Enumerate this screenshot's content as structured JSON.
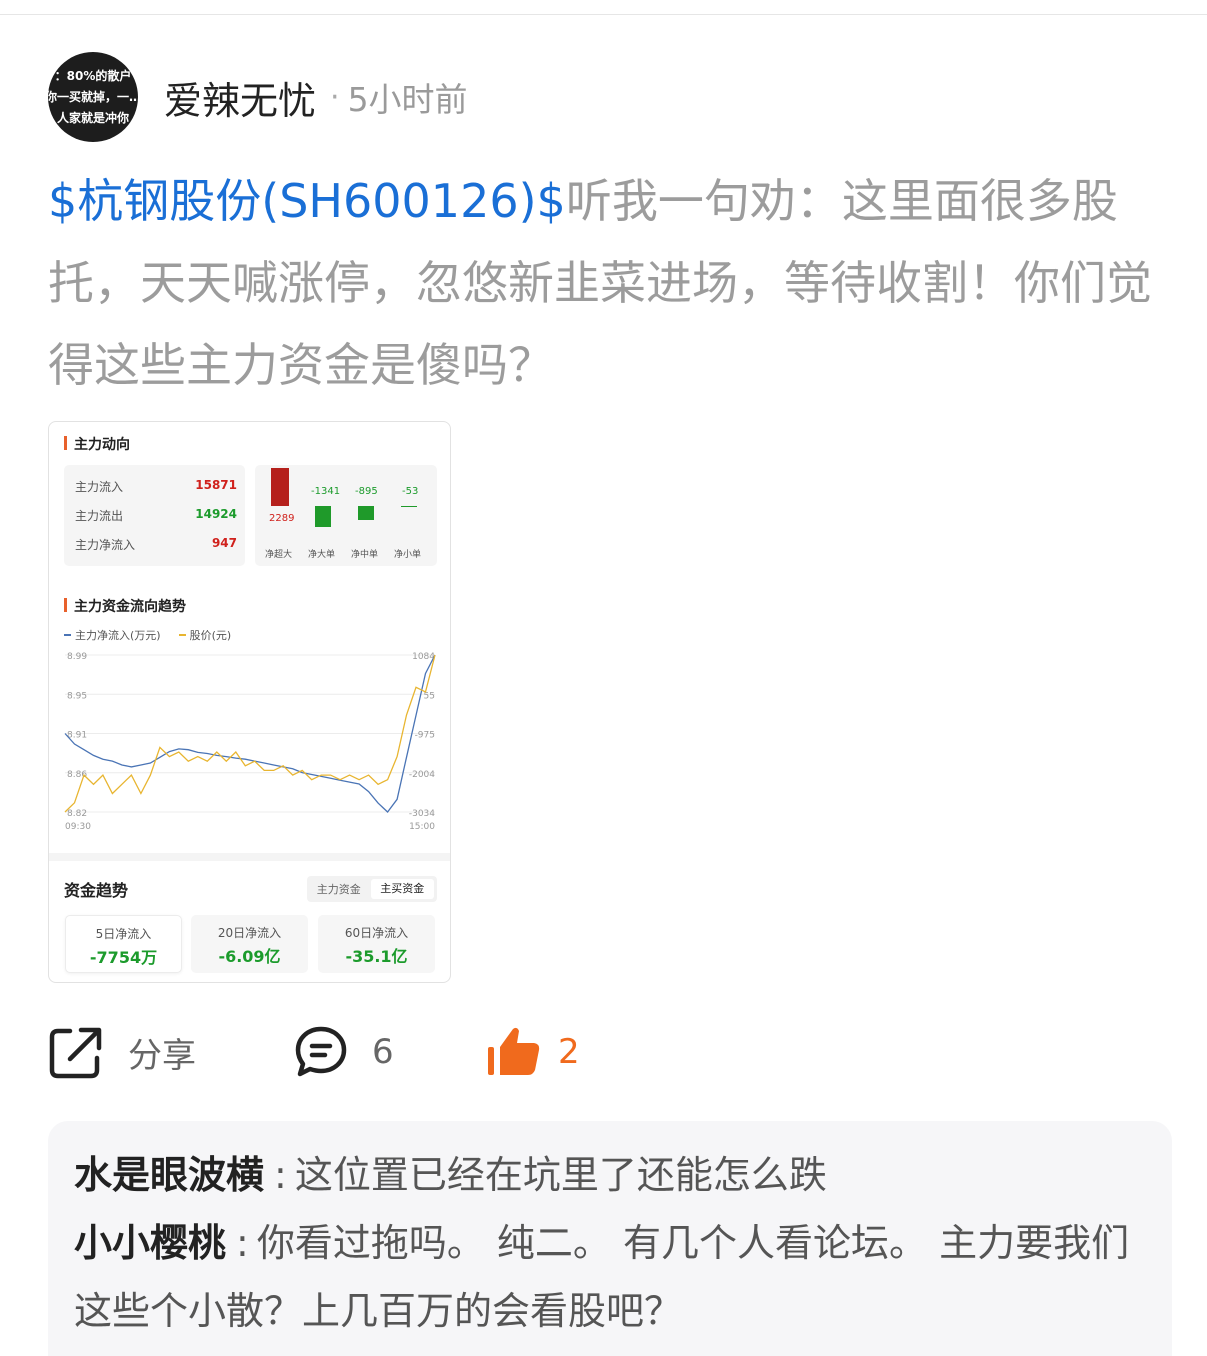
{
  "author": {
    "avatar_lines": [
      "：80%的散户",
      "你一买就掉，一…",
      "人家就是冲你"
    ],
    "name": "爱辣无忧",
    "separator": "·",
    "time": "5小时前"
  },
  "post": {
    "tag": "$杭钢股份(SH600126)$",
    "text": "听我一句劝：这里面很多股托，天天喊涨停，忽悠新韭菜进场，等待收割！你们觉得这些主力资金是傻吗？"
  },
  "card": {
    "section1_title": "主力动向",
    "flows": [
      {
        "label": "主力流入",
        "value": "15871",
        "color": "red"
      },
      {
        "label": "主力流出",
        "value": "14924",
        "color": "green"
      },
      {
        "label": "主力净流入",
        "value": "947",
        "color": "red"
      }
    ],
    "bars": [
      {
        "label": "净超大",
        "value": 2289,
        "display": "2289"
      },
      {
        "label": "净大单",
        "value": -1341,
        "display": "-1341"
      },
      {
        "label": "净中单",
        "value": -895,
        "display": "-895"
      },
      {
        "label": "净小单",
        "value": -53,
        "display": "-53"
      }
    ],
    "section2_title": "主力资金流向趋势",
    "legend": [
      {
        "label": "主力净流入(万元)",
        "color": "#4a74b5"
      },
      {
        "label": "股价(元)",
        "color": "#e8b530"
      }
    ],
    "trend_title": "资金趋势",
    "toggle": [
      "主力资金",
      "主买资金"
    ],
    "tiles": [
      {
        "label": "5日净流入",
        "value": "-7754万"
      },
      {
        "label": "20日净流入",
        "value": "-6.09亿"
      },
      {
        "label": "60日净流入",
        "value": "-35.1亿"
      }
    ]
  },
  "chart_data": {
    "type": "line",
    "x_start": "09:30",
    "x_end": "15:00",
    "left_axis_ticks": [
      "8.99",
      "8.95",
      "8.91",
      "8.86",
      "8.82"
    ],
    "right_axis_ticks": [
      "1084",
      "55",
      "-975",
      "-2004",
      "-3034"
    ],
    "series": [
      {
        "name": "主力净流入(万元)",
        "color": "#4a74b5",
        "values": [
          -975,
          -1250,
          -1400,
          -1550,
          -1650,
          -1700,
          -1800,
          -1850,
          -1800,
          -1750,
          -1600,
          -1450,
          -1380,
          -1400,
          -1470,
          -1500,
          -1550,
          -1580,
          -1620,
          -1650,
          -1700,
          -1750,
          -1800,
          -1850,
          -1900,
          -2000,
          -2050,
          -2100,
          -2150,
          -2200,
          -2250,
          -2300,
          -2500,
          -2800,
          -3034,
          -2700,
          -1600,
          -500,
          600,
          1084
        ]
      },
      {
        "name": "股价(元)",
        "color": "#e8b530",
        "values": [
          8.82,
          8.83,
          8.86,
          8.85,
          8.86,
          8.84,
          8.85,
          8.86,
          8.84,
          8.86,
          8.89,
          8.88,
          8.885,
          8.875,
          8.88,
          8.875,
          8.885,
          8.875,
          8.885,
          8.87,
          8.875,
          8.865,
          8.865,
          8.87,
          8.86,
          8.865,
          8.855,
          8.86,
          8.86,
          8.855,
          8.86,
          8.855,
          8.86,
          8.85,
          8.855,
          8.88,
          8.925,
          8.955,
          8.95,
          8.99
        ]
      }
    ]
  },
  "actions": {
    "share_label": "分享",
    "comment_count": "6",
    "like_count": "2"
  },
  "comments": [
    {
      "user": "水是眼波横",
      "separator": ":",
      "text": "这位置已经在坑里了还能怎么跌"
    },
    {
      "user": "小小樱桃",
      "separator": ":",
      "text": "你看过拖吗。 纯二。  有几个人看论坛。 主力要我们这些个小散？上几百万的会看股吧？"
    }
  ]
}
